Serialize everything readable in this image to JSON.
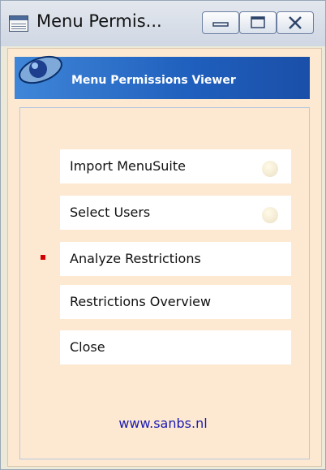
{
  "window": {
    "title": "Menu Permis...",
    "icon": "table-window-icon",
    "controls": [
      "minimize-icon",
      "maximize-icon",
      "close-icon"
    ]
  },
  "banner": {
    "title": "Menu Permissions Viewer",
    "logo": "sphere-logo-icon"
  },
  "menu": {
    "items": [
      {
        "label": "Import MenuSuite",
        "has_status_dot": true,
        "active": false
      },
      {
        "label": "Select Users",
        "has_status_dot": true,
        "active": false
      },
      {
        "label": "Analyze Restrictions",
        "has_status_dot": false,
        "active": true
      },
      {
        "label": "Restrictions Overview",
        "has_status_dot": false,
        "active": false
      },
      {
        "label": "Close",
        "has_status_dot": false,
        "active": false
      }
    ]
  },
  "footer": {
    "link_text": "www.sanbs.nl"
  },
  "colors": {
    "banner": "#1f5fbd",
    "panel_bg": "#fde9d2",
    "marker": "#d10000",
    "link": "#1a1ab3"
  }
}
